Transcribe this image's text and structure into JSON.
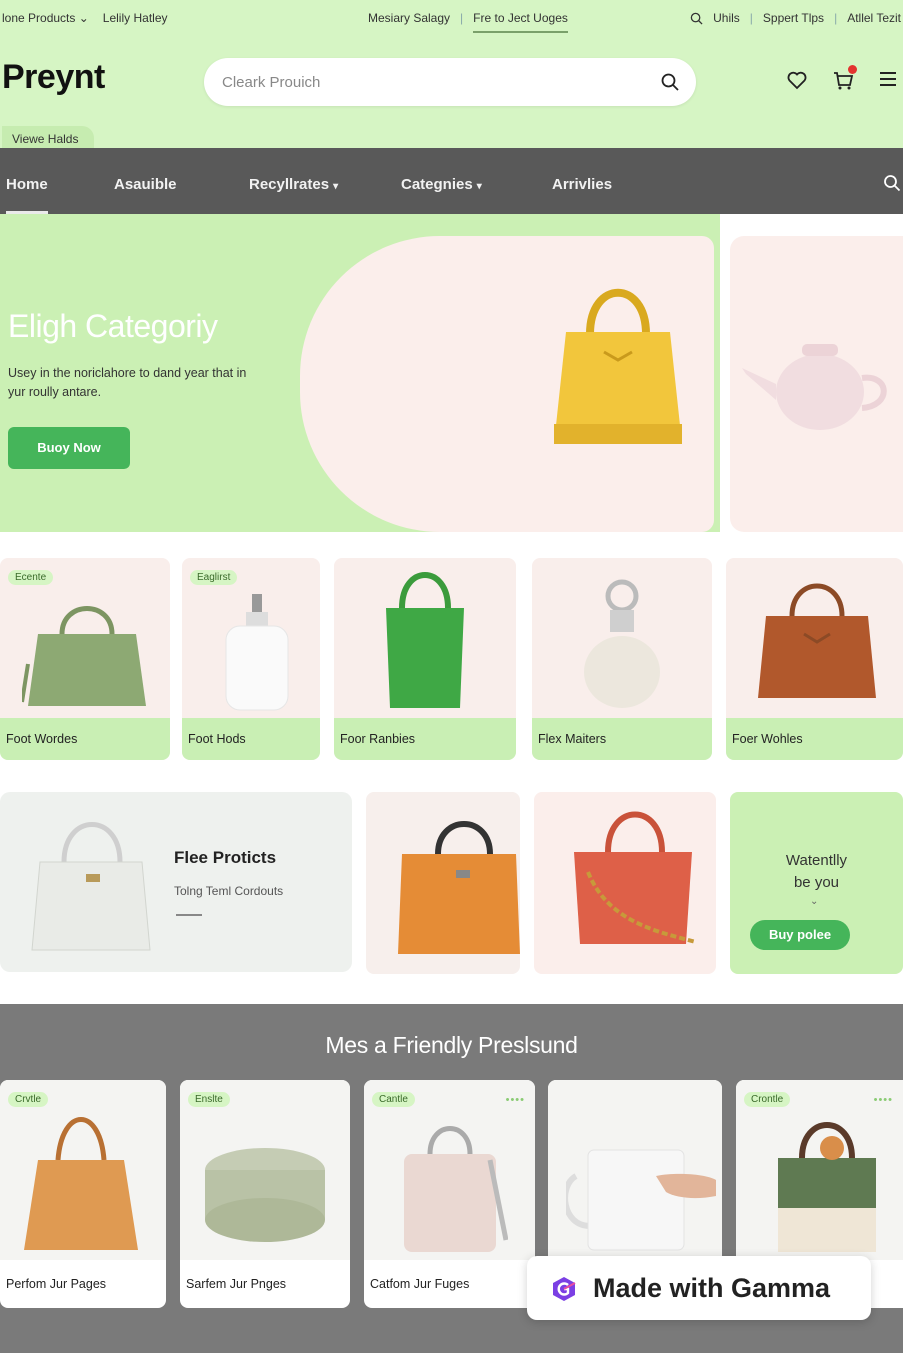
{
  "topbar": {
    "left": [
      "lone Products",
      "Lelily Hatley"
    ],
    "center": [
      "Mesiary Salagy",
      "Fre to Ject Uoges"
    ],
    "right": [
      "Uhils",
      "Sppert Tlps",
      "Atllel Tezit"
    ]
  },
  "header": {
    "logo": "Preynt",
    "search_placeholder": "Cleark Prouich",
    "view_tab": "Viewe Halds"
  },
  "nav": {
    "items": [
      "Home",
      "Asauible",
      "Recyllrates",
      "Categnies",
      "Arrivlies"
    ]
  },
  "hero": {
    "title": "Eligh Categoriy",
    "desc": "Usey in the noriclahore to dand year that in yur roully antare.",
    "button": "Buoy Now"
  },
  "products": [
    {
      "tag": "Ecente",
      "label": "Foot Wordes"
    },
    {
      "tag": "Eaglirst",
      "label": "Foot Hods"
    },
    {
      "tag": "",
      "label": "Foor Ranbies"
    },
    {
      "tag": "",
      "label": "Flex Maiters"
    },
    {
      "tag": "",
      "label": "Foer Wohles"
    }
  ],
  "feature": {
    "title": "Flee Proticts",
    "subtitle": "Tolng Teml Cordouts"
  },
  "promo": {
    "line1": "Watentlly",
    "line2": "be you",
    "button": "Buy polee"
  },
  "section": {
    "title": "Mes a Friendly Preslsund",
    "cards": [
      {
        "tag": "Crvtle",
        "label": "Perfom Jur Pages"
      },
      {
        "tag": "Enslte",
        "label": "Sarfem Jur Pnges"
      },
      {
        "tag": "Cantle",
        "label": "Catfom Jur Fuges"
      },
      {
        "tag": "",
        "label": ""
      },
      {
        "tag": "Crontle",
        "label": ""
      }
    ]
  },
  "badge": {
    "text": "Made with Gamma"
  },
  "colors": {
    "green_light": "#d6f5c4",
    "green_button": "#45b55a",
    "nav_dark": "#595959",
    "pink": "#fbeeeb"
  }
}
